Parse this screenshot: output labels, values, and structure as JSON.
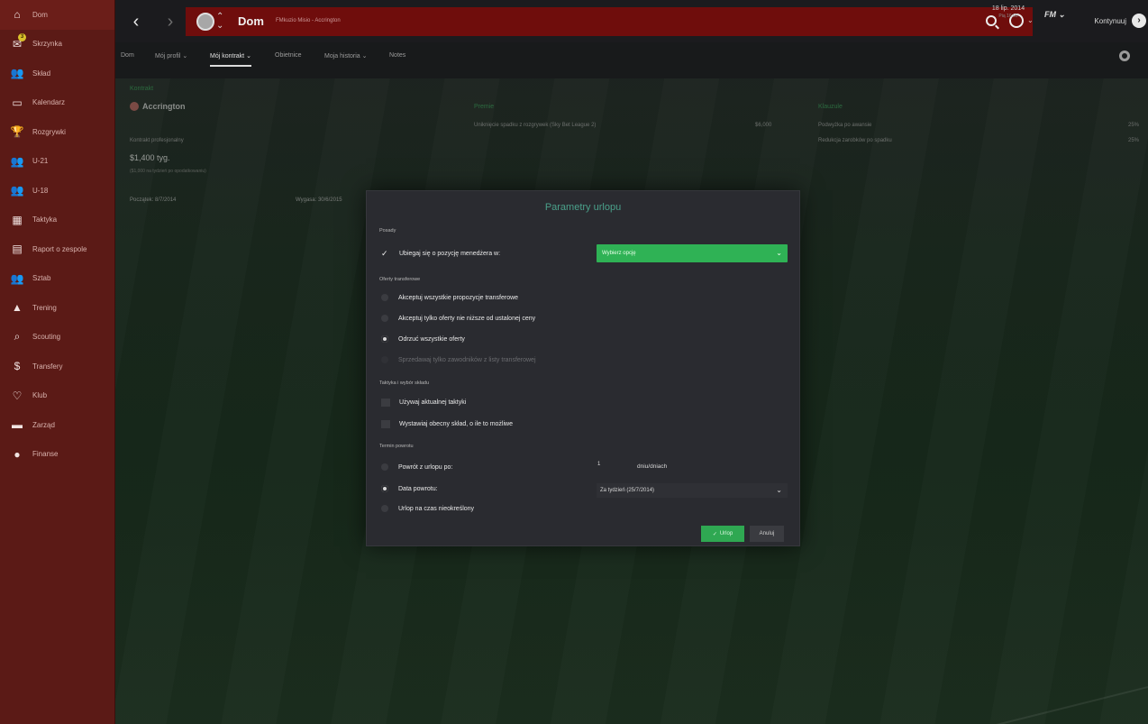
{
  "sidebar": {
    "items": [
      {
        "label": "Dom",
        "icon": "home-icon",
        "glyph": "⌂"
      },
      {
        "label": "Skrzynka",
        "icon": "inbox-icon",
        "glyph": "✉",
        "badge": "3"
      },
      {
        "label": "Skład",
        "icon": "squad-icon",
        "glyph": "👥"
      },
      {
        "label": "Kalendarz",
        "icon": "calendar-icon",
        "glyph": "▭"
      },
      {
        "label": "Rozgrywki",
        "icon": "trophy-icon",
        "glyph": "🏆"
      },
      {
        "label": "U-21",
        "icon": "u21-icon",
        "glyph": "👥"
      },
      {
        "label": "U-18",
        "icon": "u18-icon",
        "glyph": "👥"
      },
      {
        "label": "Taktyka",
        "icon": "tactics-icon",
        "glyph": "▦"
      },
      {
        "label": "Raport o zespole",
        "icon": "report-icon",
        "glyph": "▤"
      },
      {
        "label": "Sztab",
        "icon": "staff-icon",
        "glyph": "👥"
      },
      {
        "label": "Trening",
        "icon": "training-icon",
        "glyph": "▲"
      },
      {
        "label": "Scouting",
        "icon": "scouting-icon",
        "glyph": "⌕"
      },
      {
        "label": "Transfery",
        "icon": "transfers-icon",
        "glyph": "$"
      },
      {
        "label": "Klub",
        "icon": "club-icon",
        "glyph": "♡"
      },
      {
        "label": "Zarząd",
        "icon": "board-icon",
        "glyph": "▬"
      },
      {
        "label": "Finanse",
        "icon": "finance-icon",
        "glyph": "●"
      }
    ]
  },
  "header": {
    "title": "Dom",
    "subtitle": "FMkuzio Misio - Accrington",
    "manager_short": "FM",
    "date_main": "18 lip. 2014",
    "date_sub": "Pią 16:00",
    "continue_label": "Kontynuuj"
  },
  "tabs": [
    {
      "label": "Dom"
    },
    {
      "label": "Mój profil ⌄"
    },
    {
      "label": "Mój kontrakt ⌄"
    },
    {
      "label": "Obietnice"
    },
    {
      "label": "Moja historia ⌄"
    },
    {
      "label": "Notes"
    }
  ],
  "contract": {
    "section_title": "Kontrakt",
    "club": "Accrington",
    "type": "Kontrakt profesjonalny",
    "wage": "$1,400 tyg.",
    "wage_note": "($1,000 na tydzień po opodatkowaniu)",
    "start": "Początek: 8/7/2014",
    "expire": "Wygasa: 30/6/2015",
    "bonus_title": "Premie",
    "bonus_desc": "Uniknięcie spadku z rozgrywek (Sky Bet League 2)",
    "bonus_value": "$6,000",
    "clauses_title": "Klauzule",
    "clauses": [
      {
        "label": "Podwyżka po awansie",
        "value": "25%"
      },
      {
        "label": "Redukcja zarobków po spadku",
        "value": "25%"
      }
    ]
  },
  "dialog": {
    "title": "Parametry urlopu",
    "sections": {
      "jobs": "Posady",
      "transfers": "Oferty transferowe",
      "tactics": "Taktyka i wybór składu",
      "return": "Termin powrotu"
    },
    "apply_job_label": "Ubiegaj się o pozycję menedżera w:",
    "apply_job_select": "Wybierz opcję",
    "transfer_options": [
      "Akceptuj wszystkie propozycje transferowe",
      "Akceptuj tylko oferty nie niższe od ustalonej ceny",
      "Odrzuć wszystkie oferty",
      "Sprzedawaj tylko zawodników z listy transferowej"
    ],
    "transfer_selected": 2,
    "tactics_options": [
      "Używaj aktualnej taktyki",
      "Wystawiaj obecny skład, o ile to możliwe"
    ],
    "return_options": [
      "Powrót z urlopu po:",
      "Data powrotu:",
      "Urlop na czas nieokreślony"
    ],
    "return_selected": 1,
    "days_value": "1",
    "days_unit": "dniu/dniach",
    "return_date": "Za tydzień (25/7/2014)",
    "confirm_label": "Urlop",
    "cancel_label": "Anuluj"
  }
}
